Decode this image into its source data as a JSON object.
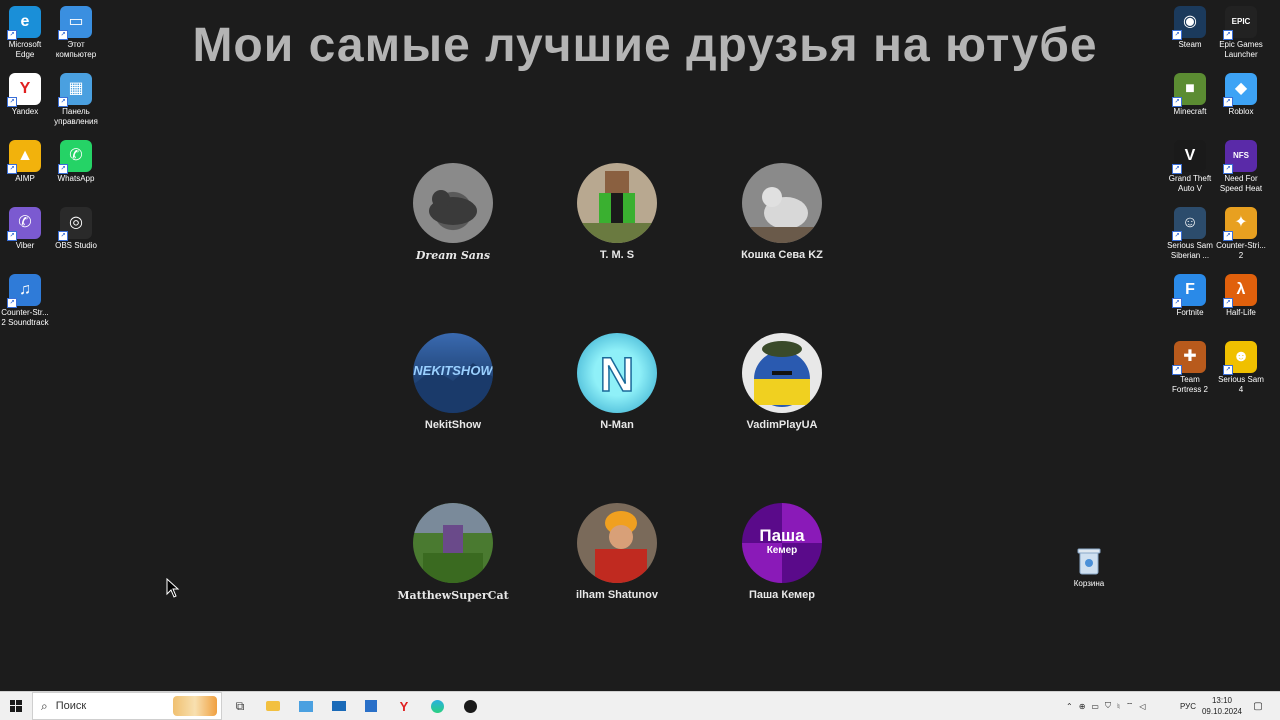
{
  "page_title": "Мои самые лучшие друзья на ютубе",
  "desktop_left": [
    {
      "label": "Microsoft Edge",
      "icon": "edge-icon",
      "color": "#1a8fd8",
      "glyph": "e"
    },
    {
      "label": "Этот компьютер",
      "icon": "computer-icon",
      "color": "#3a8fe0",
      "glyph": "▭"
    },
    {
      "label": "Yandex",
      "icon": "yandex-icon",
      "color": "#ffffff",
      "glyph": "Y"
    },
    {
      "label": "Панель управления",
      "icon": "control-panel-icon",
      "color": "#4aa0e0",
      "glyph": "▦"
    },
    {
      "label": "AIMP",
      "icon": "aimp-icon",
      "color": "#f2b20c",
      "glyph": "▲"
    },
    {
      "label": "WhatsApp",
      "icon": "whatsapp-icon",
      "color": "#25d366",
      "glyph": "✆"
    },
    {
      "label": "Viber",
      "icon": "viber-icon",
      "color": "#7b5ad0",
      "glyph": "✆"
    },
    {
      "label": "OBS Studio",
      "icon": "obs-icon",
      "color": "#2a2a2a",
      "glyph": "◎"
    },
    {
      "label": "Counter-Str... 2 Soundtrack",
      "icon": "music-icon",
      "color": "#2f7bd8",
      "glyph": "♫"
    }
  ],
  "desktop_right": [
    {
      "label": "Steam",
      "icon": "steam-icon",
      "color": "#1b3a5c",
      "glyph": "◉"
    },
    {
      "label": "Epic Games Launcher",
      "icon": "epic-games-icon",
      "color": "#222222",
      "glyph": "EPIC"
    },
    {
      "label": "Minecraft",
      "icon": "minecraft-icon",
      "color": "#5b8c32",
      "glyph": "■"
    },
    {
      "label": "Roblox",
      "icon": "roblox-icon",
      "color": "#3da3f5",
      "glyph": "◆"
    },
    {
      "label": "Grand Theft Auto V",
      "icon": "gta-icon",
      "color": "#1a1a1a",
      "glyph": "V"
    },
    {
      "label": "Need For Speed Heat",
      "icon": "nfs-icon",
      "color": "#5a2aa8",
      "glyph": "NFS"
    },
    {
      "label": "Serious Sam Siberian ...",
      "icon": "serious-sam-siberian-icon",
      "color": "#2c4c6c",
      "glyph": "☺"
    },
    {
      "label": "Counter-Stri... 2",
      "icon": "counter-strike-icon",
      "color": "#e8a020",
      "glyph": "✦"
    },
    {
      "label": "Fortnite",
      "icon": "fortnite-icon",
      "color": "#2a8ae8",
      "glyph": "F"
    },
    {
      "label": "Half-Life",
      "icon": "half-life-icon",
      "color": "#e0600c",
      "glyph": "λ"
    },
    {
      "label": "Team Fortress 2",
      "icon": "team-fortress-icon",
      "color": "#b85a1c",
      "glyph": "✚"
    },
    {
      "label": "Serious Sam 4",
      "icon": "serious-sam-4-icon",
      "color": "#f0c000",
      "glyph": "☻"
    }
  ],
  "recycle_bin": {
    "label": "Корзина"
  },
  "friends": [
    {
      "name": "Dream Sans",
      "color1": "#777777",
      "color2": "#3a3a3a"
    },
    {
      "name": "T. M. S",
      "color1": "#5aa040",
      "color2": "#2b2b2b"
    },
    {
      "name": "Кошка Сева KZ",
      "color1": "#b0b0b0",
      "color2": "#555555"
    },
    {
      "name": "NekitShow",
      "color1": "#3a6ab0",
      "color2": "#0f2a50"
    },
    {
      "name": "N-Man",
      "color1": "#4fe0e8",
      "color2": "#2aa0c8"
    },
    {
      "name": "VadimPlayUA",
      "color1": "#f0d020",
      "color2": "#3a70c0"
    },
    {
      "name": "MatthewSuperCat",
      "color1": "#4a7a30",
      "color2": "#6a4a8a"
    },
    {
      "name": "ilham Shatunov",
      "color1": "#c84020",
      "color2": "#4a3020"
    },
    {
      "name": "Паша Кемер",
      "color1": "#7a1aa0",
      "color2": "#3a0a5a"
    }
  ],
  "pasha_avatar_text": {
    "line1": "Паша",
    "line2": "Кемер"
  },
  "n_man_letter": "N",
  "nekitshow_text": "NEKITSHOW",
  "taskbar": {
    "search_placeholder": "Поиск",
    "lang": "РУС",
    "time": "13:10",
    "date": "09.10.2024"
  }
}
